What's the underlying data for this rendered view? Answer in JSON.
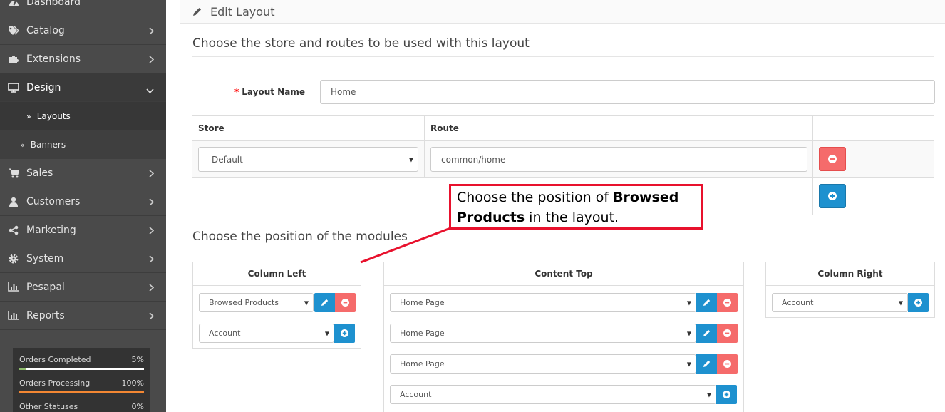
{
  "sidebar": {
    "items": [
      {
        "label": "Dashboard",
        "icon": "dashboard-icon"
      },
      {
        "label": "Catalog",
        "icon": "tags-icon"
      },
      {
        "label": "Extensions",
        "icon": "puzzle-icon"
      },
      {
        "label": "Design",
        "icon": "monitor-icon"
      },
      {
        "label": "Sales",
        "icon": "cart-icon"
      },
      {
        "label": "Customers",
        "icon": "user-icon"
      },
      {
        "label": "Marketing",
        "icon": "share-icon"
      },
      {
        "label": "System",
        "icon": "gear-icon"
      },
      {
        "label": "Pesapal",
        "icon": "bar-chart-icon"
      },
      {
        "label": "Reports",
        "icon": "bar-chart-icon"
      }
    ],
    "design_sub": [
      {
        "label": "Layouts"
      },
      {
        "label": "Banners"
      }
    ],
    "stats": [
      {
        "label": "Orders Completed",
        "percent": "5%",
        "value": 5,
        "color": "#8fbb6c"
      },
      {
        "label": "Orders Processing",
        "percent": "100%",
        "value": 100,
        "color": "#f38733"
      },
      {
        "label": "Other Statuses",
        "percent": "0%",
        "value": 0,
        "color": "#e74c3c"
      }
    ]
  },
  "panel": {
    "title": "Edit Layout",
    "section_routes": "Choose the store and routes to be used with this layout",
    "layout_name_label": "Layout Name",
    "layout_name_value": "Home",
    "table": {
      "headers": [
        "Store",
        "Route",
        ""
      ],
      "store_value": "Default",
      "route_value": "common/home"
    },
    "section_modules": "Choose the position of the modules",
    "columns": {
      "left": {
        "title": "Column Left",
        "modules": [
          "Browsed Products"
        ],
        "add_select": "Account"
      },
      "top": {
        "title": "Content Top",
        "modules": [
          "Home Page",
          "Home Page",
          "Home Page"
        ],
        "add_select": "Account"
      },
      "right": {
        "title": "Column Right",
        "modules": [],
        "add_select": "Account"
      }
    }
  },
  "annotation": {
    "pre": "Choose the position of ",
    "bold": "Browsed Products",
    "post": " in the layout.",
    "color": "#e8112d"
  }
}
